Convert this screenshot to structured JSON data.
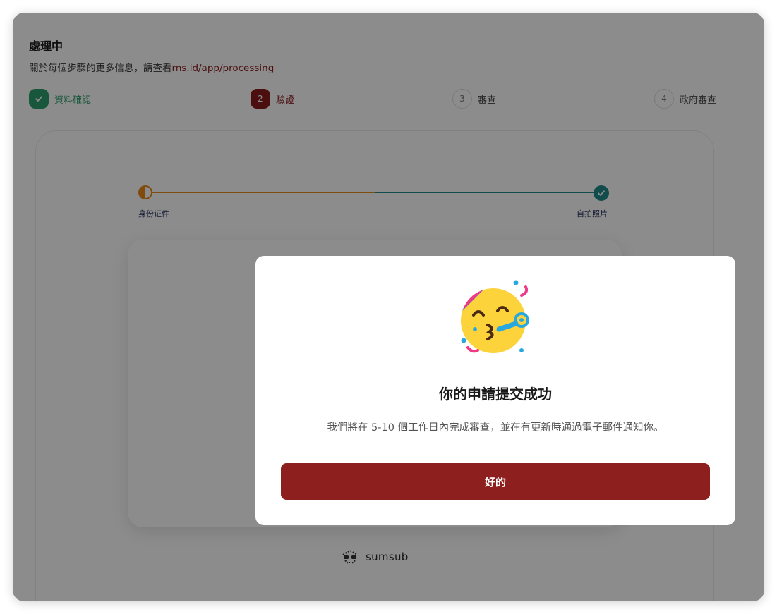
{
  "header": {
    "title": "處理中",
    "subtitle_prefix": "關於每個步驟的更多信息，請查看",
    "subtitle_link": "rns.id/app/processing"
  },
  "steps": [
    {
      "number": "",
      "label": "資料確認",
      "state": "done"
    },
    {
      "number": "2",
      "label": "驗證",
      "state": "active"
    },
    {
      "number": "3",
      "label": "審查",
      "state": "pending"
    },
    {
      "number": "4",
      "label": "政府審查",
      "state": "pending"
    }
  ],
  "verification": {
    "left_label": "身份证件",
    "right_label": "自拍照片"
  },
  "brand": {
    "name": "sumsub"
  },
  "modal": {
    "title": "你的申請提交成功",
    "description": "我們將在 5-10 個工作日內完成審查，並在有更新時通過電子郵件通知你。",
    "ok_label": "好的",
    "emoji": "partying-face-icon"
  },
  "colors": {
    "brand_red": "#8e1f1f",
    "done_green": "#2f9e6e",
    "progress_orange": "#e88a1a",
    "progress_teal": "#1f8a8a"
  }
}
